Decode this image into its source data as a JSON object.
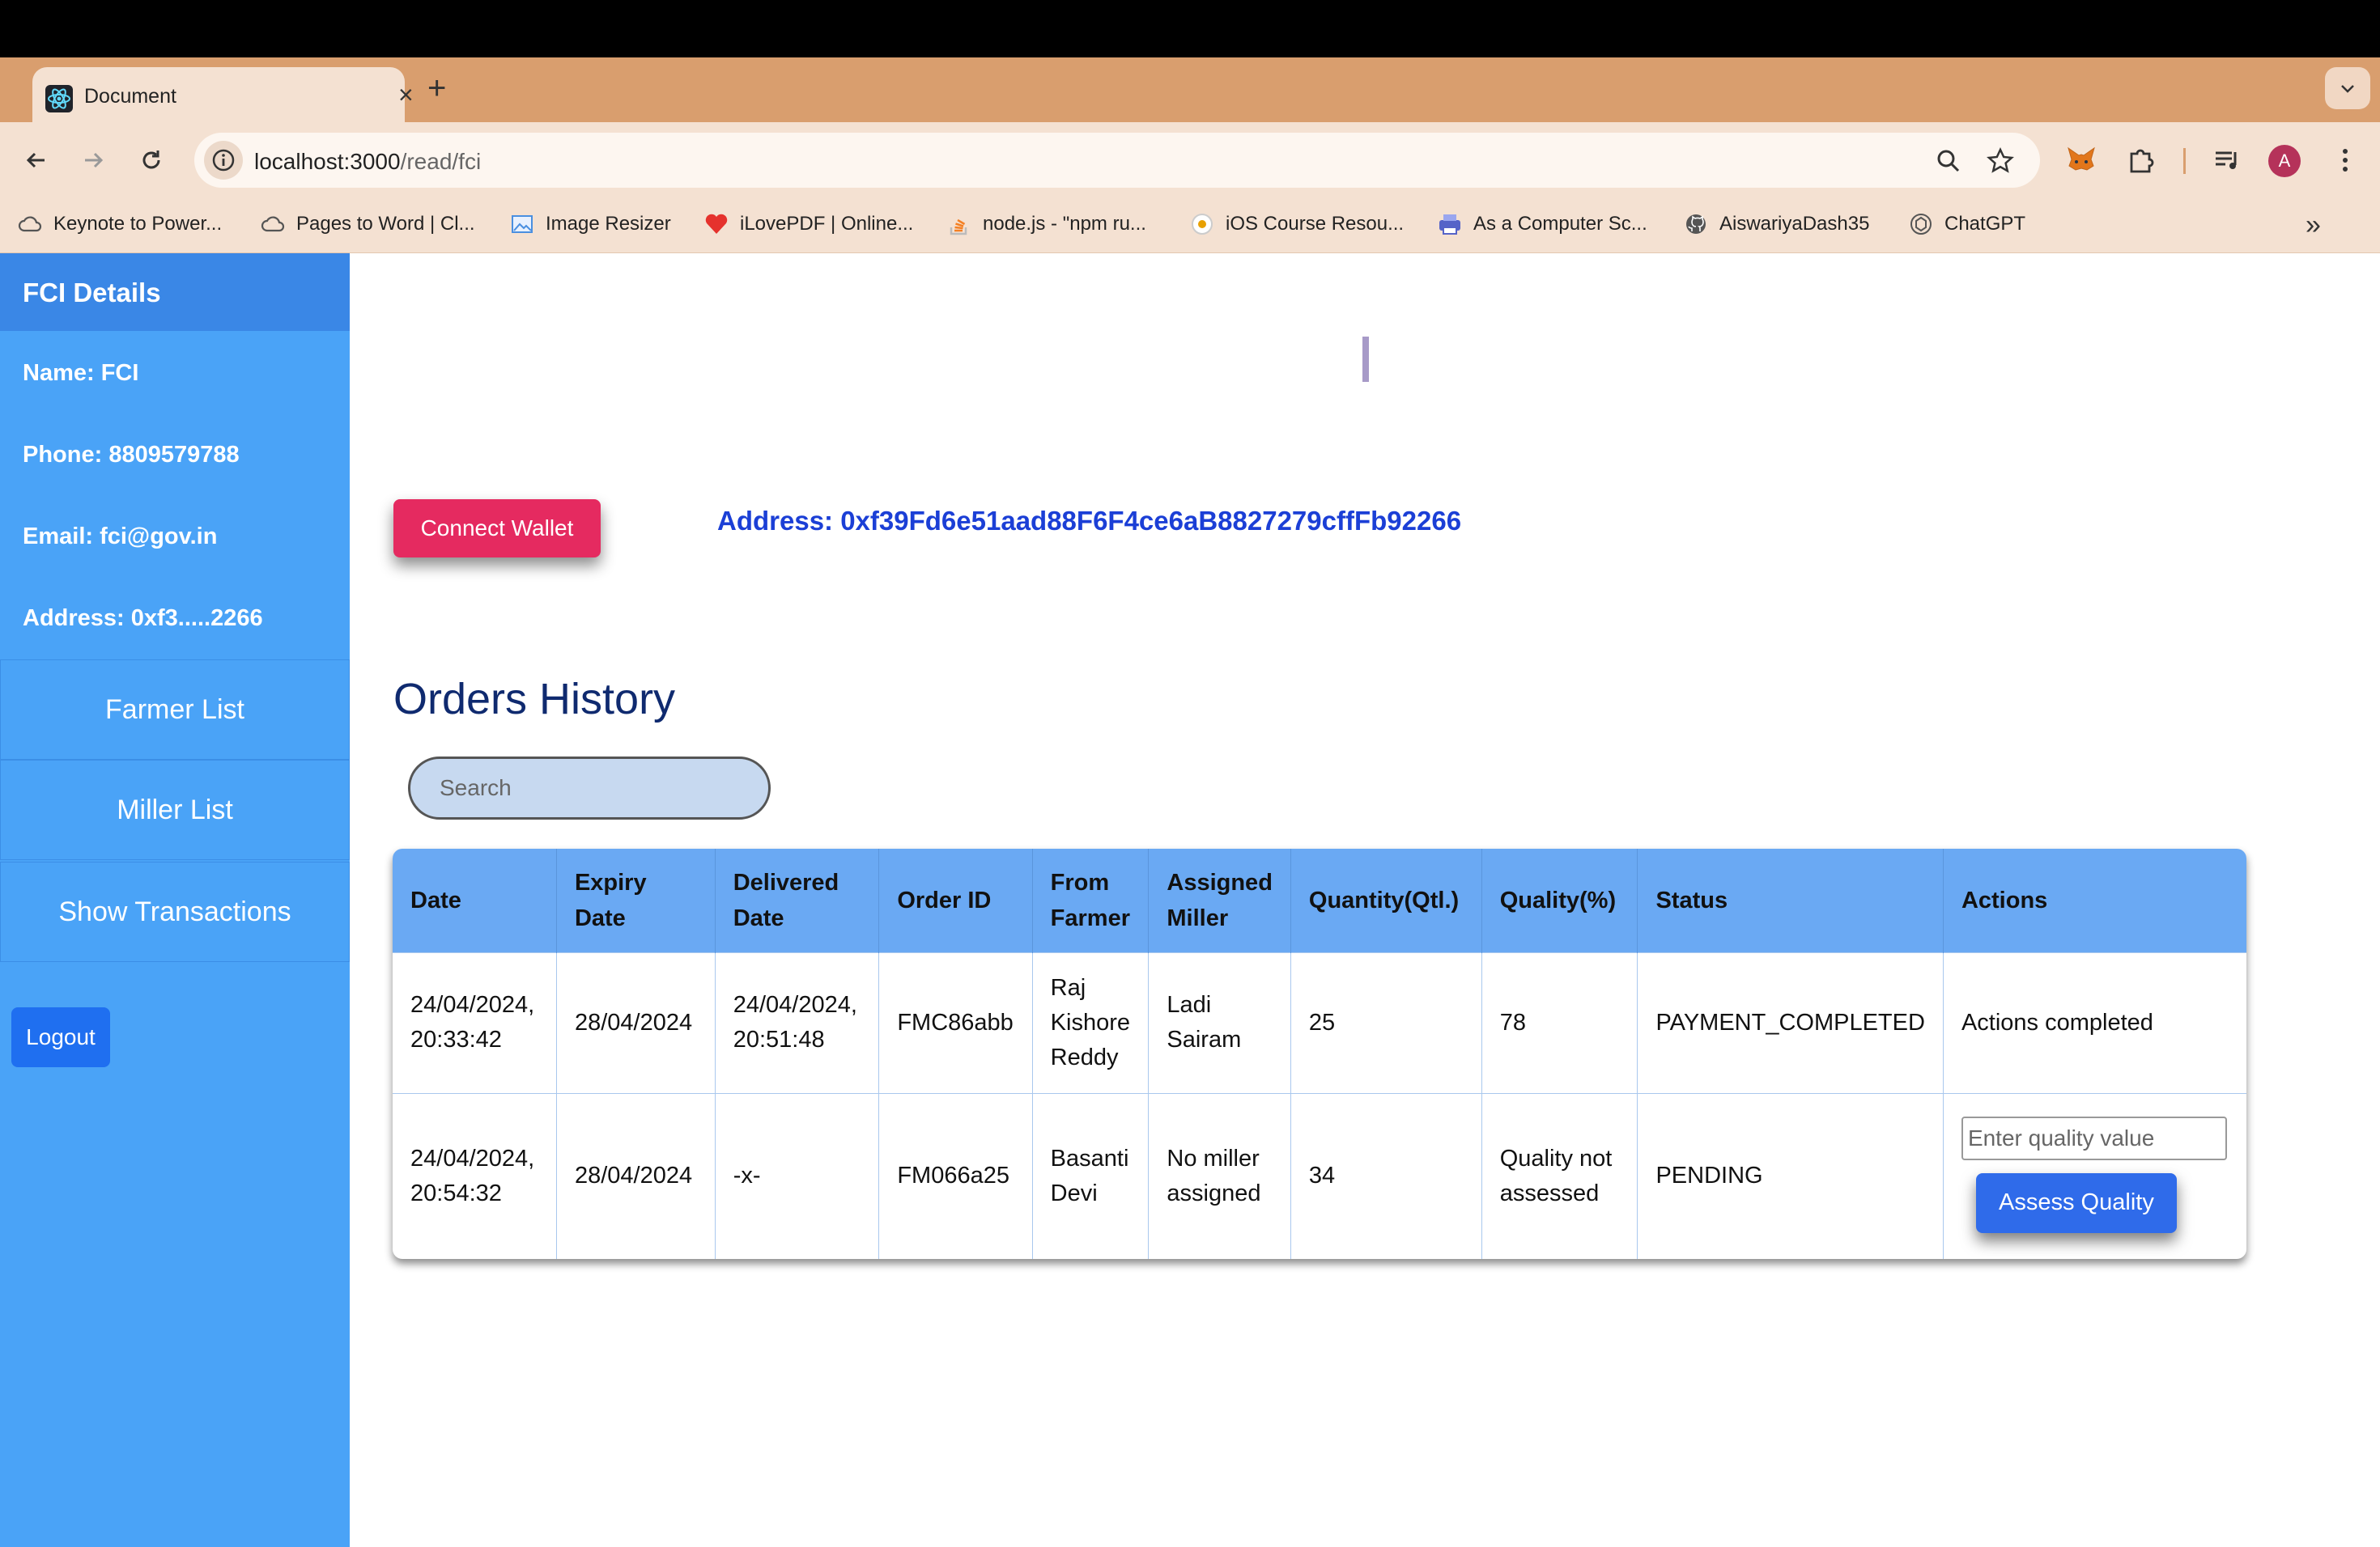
{
  "browser": {
    "tab_title": "Document",
    "url_host": "localhost:3000",
    "url_path": "/read/fci",
    "avatar_letter": "A",
    "bookmarks": [
      {
        "label": "Keynote to Power...",
        "icon": "cloud-icon"
      },
      {
        "label": "Pages to Word | Cl...",
        "icon": "cloud-icon"
      },
      {
        "label": "Image Resizer",
        "icon": "image-icon"
      },
      {
        "label": "iLovePDF | Online...",
        "icon": "heart-icon"
      },
      {
        "label": "node.js - \"npm ru...",
        "icon": "stackoverflow-icon"
      },
      {
        "label": "iOS Course Resou...",
        "icon": "course-icon"
      },
      {
        "label": "As a Computer Sc...",
        "icon": "printer-icon"
      },
      {
        "label": "AiswariyaDash35",
        "icon": "github-icon"
      },
      {
        "label": "ChatGPT",
        "icon": "chatgpt-icon"
      }
    ]
  },
  "sidebar": {
    "header": "FCI Details",
    "name": "Name: FCI",
    "phone": "Phone: 8809579788",
    "email": "Email: fci@gov.in",
    "address": "Address: 0xf3.....2266",
    "nav": [
      "Farmer List",
      "Miller List",
      "Show Transactions"
    ],
    "logout": "Logout"
  },
  "main": {
    "connect_wallet": "Connect Wallet",
    "address": "Address: 0xf39Fd6e51aad88F6F4ce6aB8827279cffFb92266",
    "orders_title": "Orders History",
    "search_placeholder": "Search",
    "table": {
      "headers": [
        "Date",
        "Expiry Date",
        "Delivered Date",
        "Order ID",
        "From Farmer",
        "Assigned Miller",
        "Quantity(Qtl.)",
        "Quality(%)",
        "Status",
        "Actions"
      ],
      "rows": [
        {
          "date": "24/04/2024, 20:33:42",
          "expiry": "28/04/2024",
          "delivered": "24/04/2024, 20:51:48",
          "order_id": "FMC86abb",
          "farmer": "Raj Kishore Reddy",
          "miller": "Ladi Sairam",
          "quantity": "25",
          "quality": "78",
          "status": "PAYMENT_COMPLETED",
          "action": "Actions completed"
        },
        {
          "date": "24/04/2024, 20:54:32",
          "expiry": "28/04/2024",
          "delivered": "-x-",
          "order_id": "FM066a25",
          "farmer": "Basanti Devi",
          "miller": "No miller assigned",
          "quantity": "34",
          "quality": "Quality not assessed",
          "status": "PENDING",
          "quality_input_placeholder": "Enter quality value",
          "assess_button": "Assess Quality"
        }
      ]
    }
  },
  "colors": {
    "sidebar_bg": "#4aa3f7",
    "sidebar_header": "#3a87e6",
    "connect_wallet": "#e52a60",
    "address_text": "#1b3fd6",
    "table_header": "#6aa9f3",
    "assess_button": "#2f6bea"
  }
}
